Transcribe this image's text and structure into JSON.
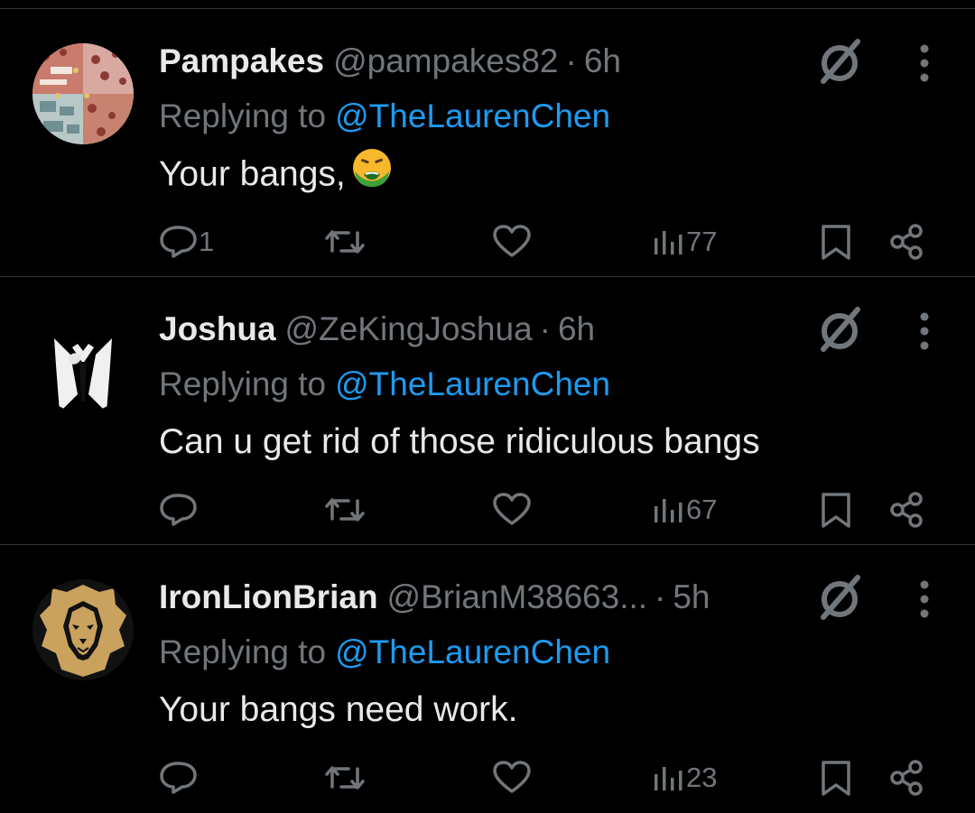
{
  "colors": {
    "background": "#000000",
    "primary_text": "#e7e9ea",
    "secondary_text": "#71767b",
    "link": "#1d9bf0",
    "divider": "#2f3336"
  },
  "replies": [
    {
      "display_name": "Pampakes",
      "handle": "@pampakes82",
      "separator": "·",
      "time": "6h",
      "replying_prefix": "Replying to",
      "replying_to": "@TheLaurenChen",
      "text": "Your bangs,",
      "emoji": "nauseated-face",
      "reply_count": "1",
      "views": "77",
      "avatar": "collage-avatar"
    },
    {
      "display_name": "Joshua",
      "handle": "@ZeKingJoshua",
      "separator": "·",
      "time": "6h",
      "replying_prefix": "Replying to",
      "replying_to": "@TheLaurenChen",
      "text": "Can u get rid of those ridiculous bangs",
      "reply_count": "",
      "views": "67",
      "avatar": "suit-avatar"
    },
    {
      "display_name": "IronLionBrian",
      "handle": "@BrianM38663...",
      "separator": "·",
      "time": "5h",
      "replying_prefix": "Replying to",
      "replying_to": "@TheLaurenChen",
      "text": "Your bangs need work.",
      "reply_count": "",
      "views": "23",
      "avatar": "lion-avatar"
    }
  ],
  "icons": {
    "grok": "grok-icon",
    "more": "more-icon",
    "reply": "reply-icon",
    "retweet": "retweet-icon",
    "like": "heart-icon",
    "views": "views-icon",
    "bookmark": "bookmark-icon",
    "share": "share-icon"
  }
}
